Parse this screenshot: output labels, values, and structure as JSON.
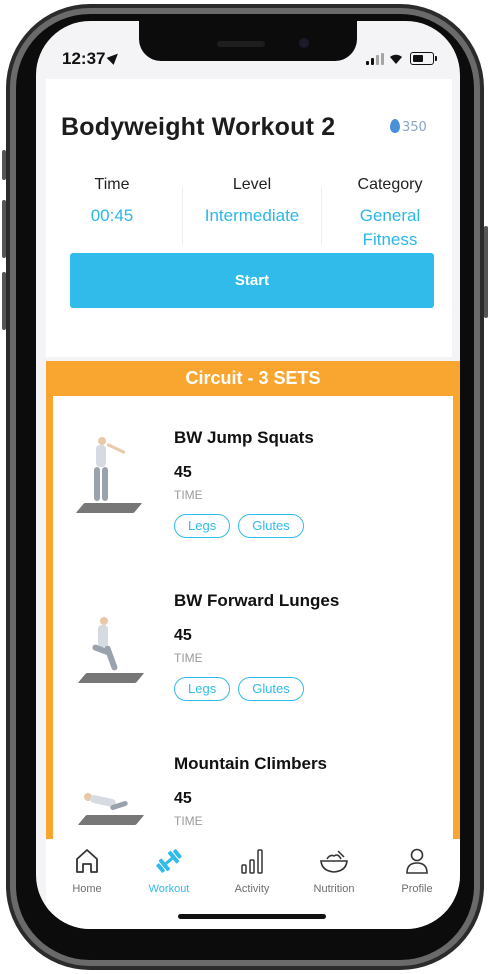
{
  "status_bar": {
    "time": "12:37"
  },
  "workout": {
    "title": "Bodyweight Workout 2",
    "calories": "350",
    "stats": [
      {
        "label": "Time",
        "value": "00:45"
      },
      {
        "label": "Level",
        "value": "Intermediate"
      },
      {
        "label": "Category",
        "value": "General Fitness"
      }
    ],
    "start_label": "Start"
  },
  "circuit": {
    "title": "Circuit - 3 SETS",
    "exercises": [
      {
        "name": "BW Jump Squats",
        "value": "45",
        "unit": "TIME",
        "tags": [
          "Legs",
          "Glutes"
        ]
      },
      {
        "name": "BW Forward Lunges",
        "value": "45",
        "unit": "TIME",
        "tags": [
          "Legs",
          "Glutes"
        ]
      },
      {
        "name": "Mountain Climbers",
        "value": "45",
        "unit": "TIME",
        "tags": []
      }
    ]
  },
  "nav": {
    "items": [
      {
        "label": "Home",
        "icon": "home-icon",
        "active": false
      },
      {
        "label": "Workout",
        "icon": "dumbbell-icon",
        "active": true
      },
      {
        "label": "Activity",
        "icon": "bar-chart-icon",
        "active": false
      },
      {
        "label": "Nutrition",
        "icon": "bowl-icon",
        "active": false
      },
      {
        "label": "Profile",
        "icon": "person-icon",
        "active": false
      }
    ]
  },
  "colors": {
    "accent": "#30bbea",
    "circuit": "#f9a630",
    "flame": "#4a90d9"
  }
}
